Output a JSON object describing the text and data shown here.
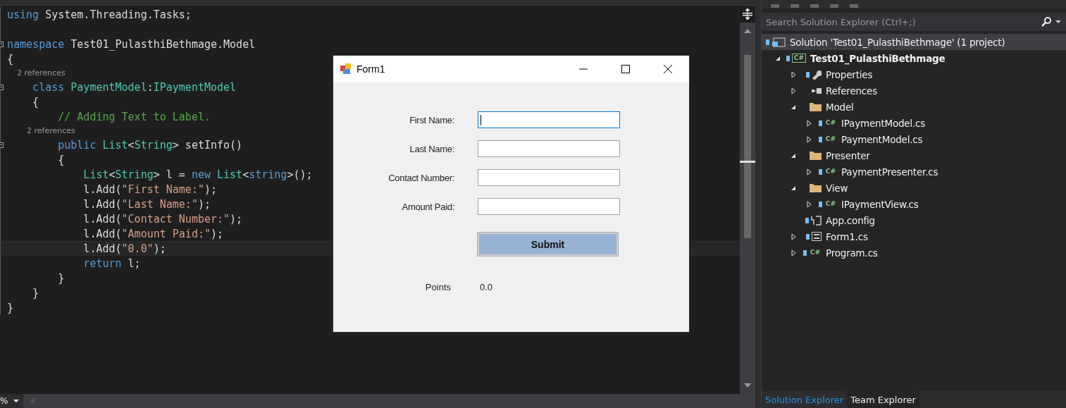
{
  "editor": {
    "lines": [
      {
        "kind": "code",
        "tokens": [
          {
            "kind": "keyword",
            "text": "using"
          },
          {
            "kind": "plain",
            "text": " System.Threading.Tasks;"
          }
        ]
      },
      {
        "kind": "blank"
      },
      {
        "kind": "code",
        "collapsible": true,
        "tokens": [
          {
            "kind": "keyword",
            "text": "namespace"
          },
          {
            "kind": "plain",
            "text": " Test01_PulasthiBethmage.Model"
          }
        ]
      },
      {
        "kind": "code",
        "tokens": [
          {
            "kind": "plain",
            "text": "{"
          }
        ]
      },
      {
        "kind": "lens",
        "text": "    2 references"
      },
      {
        "kind": "code",
        "collapsible": true,
        "tokens": [
          {
            "kind": "keyword",
            "text": "    class "
          },
          {
            "kind": "type",
            "text": "PaymentModel"
          },
          {
            "kind": "plain",
            "text": ":"
          },
          {
            "kind": "type",
            "text": "IPaymentModel"
          }
        ]
      },
      {
        "kind": "code",
        "tokens": [
          {
            "kind": "plain",
            "text": "    {"
          }
        ]
      },
      {
        "kind": "code",
        "tokens": [
          {
            "kind": "comment",
            "text": "        // Adding Text to Label."
          }
        ]
      },
      {
        "kind": "lens",
        "text": "        2 references"
      },
      {
        "kind": "code",
        "collapsible": true,
        "tokens": [
          {
            "kind": "keyword",
            "text": "        public "
          },
          {
            "kind": "type",
            "text": "List"
          },
          {
            "kind": "plain",
            "text": "<"
          },
          {
            "kind": "type",
            "text": "String"
          },
          {
            "kind": "plain",
            "text": "> setInfo()"
          }
        ]
      },
      {
        "kind": "code",
        "tokens": [
          {
            "kind": "plain",
            "text": "        {"
          }
        ]
      },
      {
        "kind": "code",
        "tokens": [
          {
            "kind": "type",
            "text": "            List"
          },
          {
            "kind": "plain",
            "text": "<"
          },
          {
            "kind": "type",
            "text": "String"
          },
          {
            "kind": "plain",
            "text": "> l = "
          },
          {
            "kind": "keyword",
            "text": "new "
          },
          {
            "kind": "type",
            "text": "List"
          },
          {
            "kind": "plain",
            "text": "<"
          },
          {
            "kind": "keyword",
            "text": "string"
          },
          {
            "kind": "plain",
            "text": ">();"
          }
        ]
      },
      {
        "kind": "code",
        "tokens": [
          {
            "kind": "plain",
            "text": "            l.Add("
          },
          {
            "kind": "string",
            "text": "\"First Name:\""
          },
          {
            "kind": "plain",
            "text": ");"
          }
        ]
      },
      {
        "kind": "code",
        "tokens": [
          {
            "kind": "plain",
            "text": "            l.Add("
          },
          {
            "kind": "string",
            "text": "\"Last Name:\""
          },
          {
            "kind": "plain",
            "text": ");"
          }
        ]
      },
      {
        "kind": "code",
        "tokens": [
          {
            "kind": "plain",
            "text": "            l.Add("
          },
          {
            "kind": "string",
            "text": "\"Contact Number:\""
          },
          {
            "kind": "plain",
            "text": ");"
          }
        ]
      },
      {
        "kind": "code",
        "tokens": [
          {
            "kind": "plain",
            "text": "            l.Add("
          },
          {
            "kind": "string",
            "text": "\"Amount Paid:\""
          },
          {
            "kind": "plain",
            "text": ");"
          }
        ]
      },
      {
        "kind": "code",
        "current": true,
        "tokens": [
          {
            "kind": "plain",
            "text": "            l.Add("
          },
          {
            "kind": "string",
            "text": "\"0.0\""
          },
          {
            "kind": "plain",
            "text": ");"
          }
        ]
      },
      {
        "kind": "code",
        "tokens": [
          {
            "kind": "keyword",
            "text": "            return"
          },
          {
            "kind": "plain",
            "text": " l;"
          }
        ]
      },
      {
        "kind": "code",
        "tokens": [
          {
            "kind": "plain",
            "text": "        }"
          }
        ]
      },
      {
        "kind": "code",
        "tokens": [
          {
            "kind": "plain",
            "text": "    }"
          }
        ]
      },
      {
        "kind": "code",
        "tokens": [
          {
            "kind": "plain",
            "text": "}"
          }
        ]
      }
    ],
    "zoom": "%"
  },
  "form_window": {
    "title": "Form1",
    "fields": [
      {
        "label": "First Name:",
        "focused": true
      },
      {
        "label": "Last Name:",
        "focused": false
      },
      {
        "label": "Contact Number:",
        "focused": false
      },
      {
        "label": "Amount Paid:",
        "focused": false
      }
    ],
    "submit_button": "Submit",
    "points_label": "Points",
    "points_value": "0.0"
  },
  "solution_explorer": {
    "search": {
      "placeholder": "Search Solution Explorer (Ctrl+;)"
    },
    "tree": [
      {
        "label": "Solution 'Test01_PulasthiBethmage' (1 project)",
        "kind": "solution",
        "selected": true,
        "children": [
          {
            "label": "Test01_PulasthiBethmage",
            "kind": "project",
            "badge": "C#",
            "bold": true,
            "selected": false,
            "expanded": true,
            "children": [
              {
                "label": "Properties",
                "kind": "properties",
                "selected": false,
                "expanded": false
              },
              {
                "label": "References",
                "kind": "references",
                "selected": false,
                "expanded": false
              },
              {
                "label": "Model",
                "kind": "folder",
                "selected": false,
                "expanded": true,
                "children": [
                  {
                    "label": "IPaymentModel.cs",
                    "kind": "code",
                    "badge": "C#",
                    "selected": false,
                    "expanded": false
                  },
                  {
                    "label": "PaymentModel.cs",
                    "kind": "code",
                    "badge": "C#",
                    "selected": false,
                    "expanded": false
                  }
                ]
              },
              {
                "label": "Presenter",
                "kind": "folder",
                "selected": false,
                "expanded": true,
                "children": [
                  {
                    "label": "PaymentPresenter.cs",
                    "kind": "code",
                    "badge": "C#",
                    "selected": false,
                    "expanded": false
                  }
                ]
              },
              {
                "label": "View",
                "kind": "folder",
                "selected": false,
                "expanded": true,
                "children": [
                  {
                    "label": "IPaymentView.cs",
                    "kind": "code",
                    "badge": "C#",
                    "selected": false,
                    "expanded": false
                  }
                ]
              },
              {
                "label": "App.config",
                "kind": "config",
                "selected": false
              },
              {
                "label": "Form1.cs",
                "kind": "form",
                "selected": false,
                "expanded": false
              },
              {
                "label": "Program.cs",
                "kind": "code",
                "badge": "C#",
                "selected": false,
                "expanded": false
              }
            ]
          }
        ]
      }
    ],
    "tabs": [
      {
        "label": "Solution Explorer",
        "selected": true
      },
      {
        "label": "Team Explorer",
        "selected": false
      }
    ]
  }
}
